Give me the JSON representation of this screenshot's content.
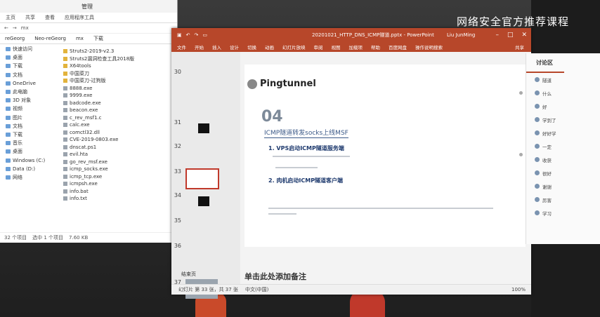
{
  "watermark": "网络安全官方推荐课程",
  "explorer": {
    "title": "管理",
    "ribbon": [
      "主页",
      "共享",
      "查看",
      "应用程序工具"
    ],
    "path": "mx",
    "tabs": [
      "reGeorg",
      "Neo-reGeorg",
      "mx",
      "下载"
    ],
    "nav": [
      "快速访问",
      "桌面",
      "下载",
      "文档",
      "OneDrive",
      "此电脑",
      "3D 对象",
      "视频",
      "图片",
      "文档",
      "下载",
      "音乐",
      "桌面",
      "Windows (C:)",
      "Data (D:)",
      "网络"
    ],
    "files": [
      {
        "name": "Struts2-2019-v2.3",
        "type": "folder"
      },
      {
        "name": "Struts2漏洞检查工具2018版",
        "type": "folder"
      },
      {
        "name": "X64tools",
        "type": "folder"
      },
      {
        "name": "中国菜刀",
        "type": "folder"
      },
      {
        "name": "中国菜刀-过狗版",
        "type": "folder"
      },
      {
        "name": "8888.exe",
        "type": "file"
      },
      {
        "name": "9999.exe",
        "type": "file"
      },
      {
        "name": "badcode.exe",
        "type": "file"
      },
      {
        "name": "beacon.exe",
        "type": "file"
      },
      {
        "name": "c_rev_msf1.c",
        "type": "file"
      },
      {
        "name": "calc.exe",
        "type": "file"
      },
      {
        "name": "comctl32.dll",
        "type": "file"
      },
      {
        "name": "CVE-2019-0803.exe",
        "type": "file"
      },
      {
        "name": "dnscat.ps1",
        "type": "file"
      },
      {
        "name": "evil.hta",
        "type": "file"
      },
      {
        "name": "go_rev_msf.exe",
        "type": "file"
      },
      {
        "name": "icmp_socks.exe",
        "type": "file"
      },
      {
        "name": "icmp_tcp.exe",
        "type": "file"
      },
      {
        "name": "icmpsh.exe",
        "type": "file"
      },
      {
        "name": "info.bat",
        "type": "file"
      },
      {
        "name": "info.txt",
        "type": "file"
      }
    ],
    "status": [
      "32 个项目",
      "选中 1 个项目",
      "7.60 KB"
    ]
  },
  "ppt": {
    "quick_access": [
      "保存",
      "撤销",
      "重做",
      "开始演示"
    ],
    "doc_title": "20201021_HTTP_DNS_ICMP隧道.pptx - PowerPoint",
    "user": "Liu JunMing",
    "window_controls": [
      "最小化",
      "还原",
      "关闭"
    ],
    "tabs": [
      "文件",
      "开始",
      "插入",
      "设计",
      "切换",
      "动画",
      "幻灯片放映",
      "审阅",
      "视图",
      "加载项",
      "帮助",
      "百度网盘",
      "操作说明搜索"
    ],
    "share": "共享",
    "thumbs": [
      {
        "num": "30"
      },
      {
        "num": "31"
      },
      {
        "num": "32"
      },
      {
        "num": "33"
      },
      {
        "num": "34"
      },
      {
        "num": "35"
      },
      {
        "num": "36"
      },
      {
        "num": "37"
      }
    ],
    "section": "结束页",
    "slide": {
      "logo": "Pingtunnel",
      "number": "04",
      "subtitle": "ICMP隧道转发socks上线MSF",
      "step1": "1. VPS启动ICMP隧道服务端",
      "step2": "2. 肉机启动ICMP隧道客户端"
    },
    "notes": "单击此处添加备注",
    "status": [
      "幻灯片 第 33 张，共 37 张",
      "中文(中国)"
    ],
    "zoom": "100%"
  },
  "comments": {
    "header": "讨论区",
    "items": [
      "隧道",
      "什么",
      "好",
      "学到了",
      "好好学",
      "一定",
      "收获",
      "很好",
      "谢谢",
      "厉害",
      "学习"
    ]
  }
}
